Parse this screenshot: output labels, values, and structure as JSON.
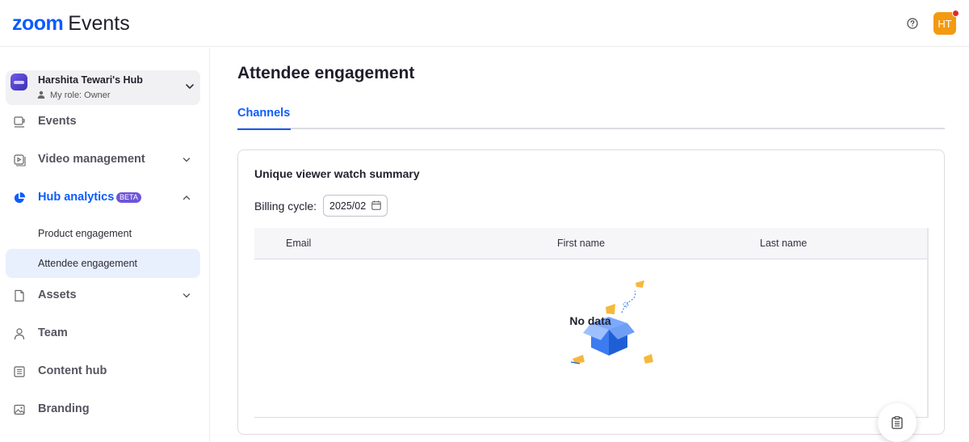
{
  "app": {
    "logo_primary": "zoom",
    "logo_secondary": "Events",
    "help_icon": "help-circle-icon",
    "avatar_initials": "HT",
    "avatar_color": "#f39a13",
    "notification_color": "#e02828"
  },
  "sidebar": {
    "hub": {
      "name": "Harshita Tewari's Hub",
      "role": "My role: Owner"
    },
    "items": [
      {
        "label": "Events",
        "icon": "events-icon"
      },
      {
        "label": "Video management",
        "icon": "video-icon",
        "expandable": true
      },
      {
        "label": "Hub analytics",
        "icon": "pie-chart-icon",
        "badge": "BETA",
        "expanded": true,
        "active": true
      },
      {
        "label": "Assets",
        "icon": "file-icon",
        "expandable": true
      },
      {
        "label": "Team",
        "icon": "person-icon"
      },
      {
        "label": "Content hub",
        "icon": "list-icon"
      },
      {
        "label": "Branding",
        "icon": "image-icon"
      }
    ],
    "subitems": [
      {
        "label": "Product engagement"
      },
      {
        "label": "Attendee engagement",
        "active": true
      }
    ]
  },
  "main": {
    "title": "Attendee engagement",
    "tabs": [
      {
        "label": "Channels",
        "active": true
      }
    ],
    "card": {
      "title": "Unique viewer watch summary",
      "billing_label": "Billing cycle:",
      "billing_value": "2025/02",
      "columns": [
        "Email",
        "First name",
        "Last name"
      ],
      "empty_text": "No data"
    }
  },
  "colors": {
    "accent": "#0b5cff",
    "beta_badge": "#6f55d9",
    "active_bg": "#e8f0fd"
  },
  "fab": {
    "icon": "clipboard-icon"
  }
}
